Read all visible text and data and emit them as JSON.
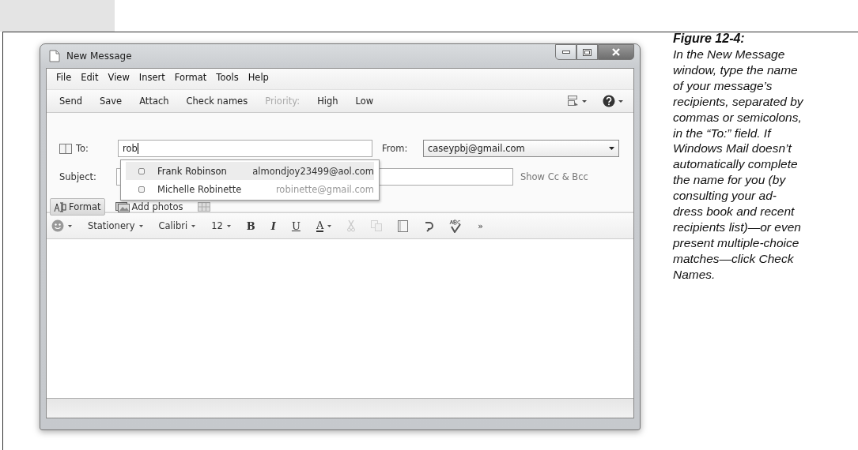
{
  "window": {
    "title": "New Message"
  },
  "menu": [
    "File",
    "Edit",
    "View",
    "Insert",
    "Format",
    "Tools",
    "Help"
  ],
  "toolbar": [
    {
      "kind": "text",
      "label": "Send",
      "disabled": false
    },
    {
      "kind": "text",
      "label": "Save",
      "disabled": false
    },
    {
      "kind": "text",
      "label": "Attach",
      "disabled": false
    },
    {
      "kind": "text",
      "label": "Check names",
      "disabled": false
    },
    {
      "kind": "text",
      "label": "Priority:",
      "disabled": true
    },
    {
      "kind": "text",
      "label": "High",
      "disabled": false
    },
    {
      "kind": "text",
      "label": "Low",
      "disabled": false
    },
    {
      "kind": "layout-menu",
      "disabled": false
    },
    {
      "kind": "help-menu",
      "disabled": false
    }
  ],
  "to": {
    "label": "To:",
    "value": "rob"
  },
  "from": {
    "label": "From:",
    "value": "caseypbj@gmail.com"
  },
  "subject": {
    "label": "Subject:"
  },
  "show_cc_bcc": "Show Cc & Bcc",
  "suggestions": [
    {
      "name": "Frank Robinson",
      "email": "almondjoy23499@aol.com",
      "selected": true
    },
    {
      "name": "Michelle Robinette",
      "email": "robinette@gmail.com",
      "selected": false
    }
  ],
  "format_bar": [
    {
      "kind": "format",
      "label": "Format",
      "selected": true
    },
    {
      "kind": "photos",
      "label": "Add photos",
      "selected": false
    },
    {
      "kind": "covered",
      "selected": false
    }
  ],
  "format_toolbar": [
    {
      "kind": "emoji",
      "disabled": false
    },
    {
      "kind": "text",
      "label": "Stationery",
      "disabled": false
    },
    {
      "kind": "text",
      "label": "Calibri",
      "disabled": false
    },
    {
      "kind": "text",
      "label": "12",
      "disabled": false
    },
    {
      "kind": "bold",
      "label": "B",
      "disabled": false
    },
    {
      "kind": "italic",
      "label": "I",
      "disabled": false
    },
    {
      "kind": "underline",
      "label": "U",
      "disabled": false
    },
    {
      "kind": "font-color",
      "label": "A",
      "disabled": false
    },
    {
      "kind": "cut",
      "disabled": true
    },
    {
      "kind": "copy",
      "disabled": true
    },
    {
      "kind": "paste",
      "disabled": false
    },
    {
      "kind": "undo",
      "disabled": false
    },
    {
      "kind": "spelling",
      "disabled": false
    },
    {
      "kind": "more",
      "label": "»",
      "disabled": false
    }
  ],
  "caption": {
    "title": "Figure 12-4:",
    "lines": [
      "In the New Message",
      "window, type the name",
      "of your message’s",
      "recipients, separated by",
      "commas or semicolons,",
      "in the “To:” field. If",
      "Windows Mail doesn’t",
      "automatically complete",
      "the name for you (by",
      "consulting your ad-",
      "dress book and recent",
      "recipients list)—or even",
      "present multiple-choice",
      "matches—click Check",
      "Names."
    ]
  }
}
